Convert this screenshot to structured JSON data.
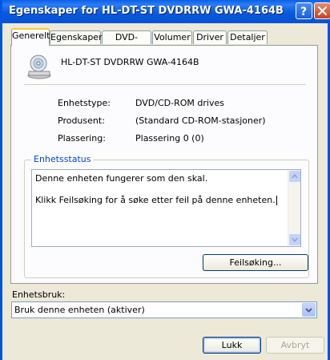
{
  "window": {
    "title": "Egenskaper for HL-DT-ST DVDRRW GWA-4164B",
    "help_icon": "help-icon",
    "close_icon": "close-icon"
  },
  "tabs": [
    {
      "label": "Generelt",
      "active": true
    },
    {
      "label": "Egenskaper",
      "active": false
    },
    {
      "label": "DVD-region",
      "active": false
    },
    {
      "label": "Volumer",
      "active": false
    },
    {
      "label": "Driver",
      "active": false
    },
    {
      "label": "Detaljer",
      "active": false
    }
  ],
  "device": {
    "icon": "dvd-drive-icon",
    "name": "HL-DT-ST DVDRRW GWA-4164B"
  },
  "properties": [
    {
      "label": "Enhetstype:",
      "value": "DVD/CD-ROM drives"
    },
    {
      "label": "Produsent:",
      "value": "(Standard CD-ROM-stasjoner)"
    },
    {
      "label": "Plassering:",
      "value": "Plassering 0 (0)"
    }
  ],
  "status": {
    "group_title": "Enhetsstatus",
    "line1": "Denne enheten fungerer som den skal.",
    "line2": "Klikk Feilsøking for å søke etter feil på denne enheten.",
    "troubleshoot_label": "Feilsøking..."
  },
  "usage": {
    "label": "Enhetsbruk:",
    "selected": "Bruk denne enheten (aktiver)"
  },
  "buttons": {
    "ok": "Lukk",
    "cancel": "Avbryt"
  },
  "colors": {
    "titlebar": "#0a58dd",
    "window_bg": "#ece9d8",
    "group_title": "#0046d5",
    "active_tab_highlight": "#ffc83c"
  }
}
